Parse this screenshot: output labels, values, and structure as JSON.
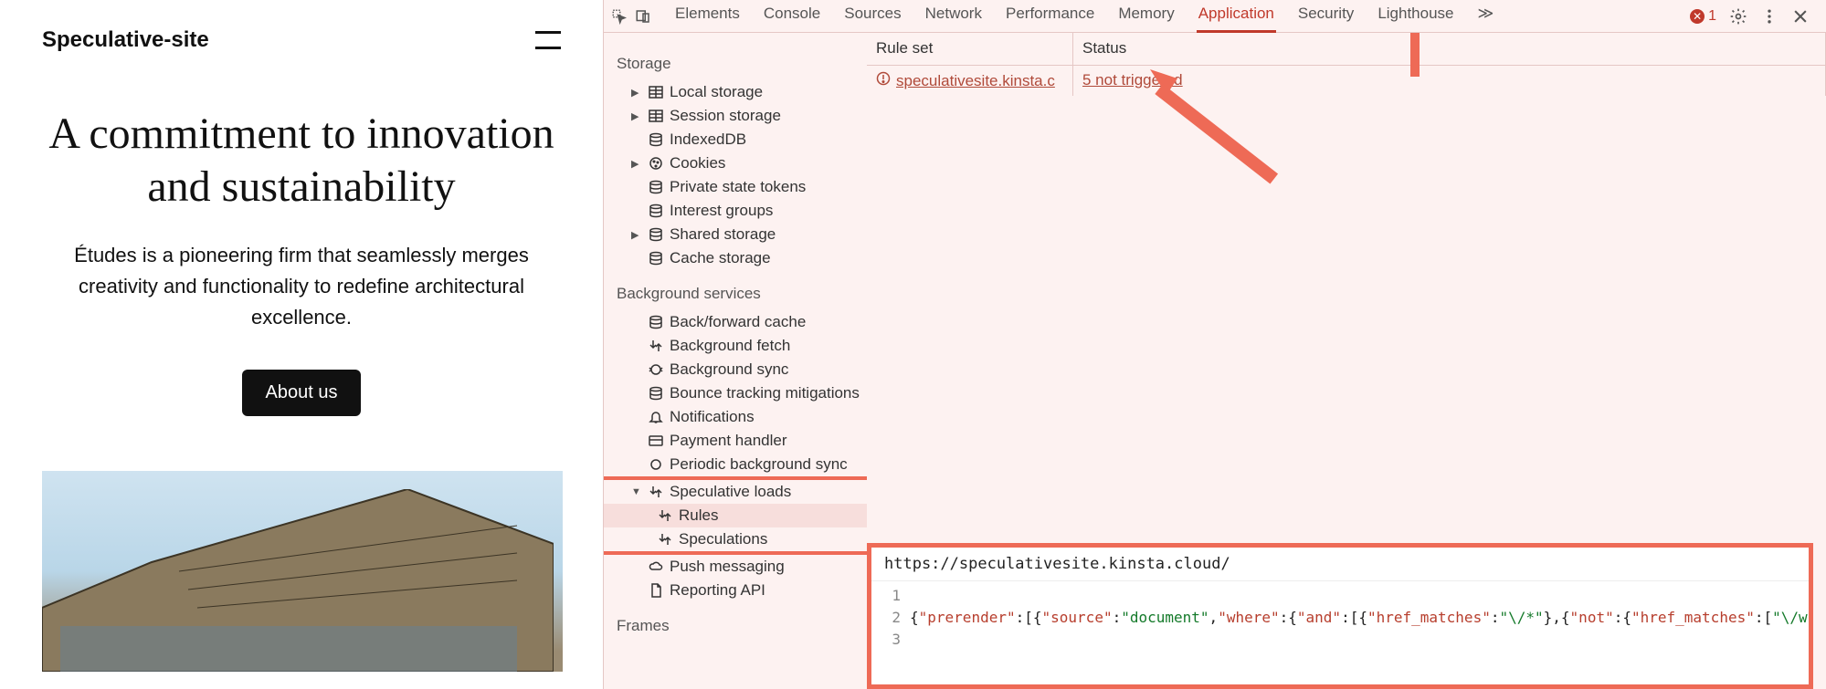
{
  "website": {
    "title": "Speculative-site",
    "heading": "A commitment to innovation and sustainability",
    "sub": "Études is a pioneering firm that seamlessly merges creativity and functionality to redefine architectural excellence.",
    "button": "About us"
  },
  "devtools": {
    "tabs": [
      "Elements",
      "Console",
      "Sources",
      "Network",
      "Performance",
      "Memory",
      "Application",
      "Security",
      "Lighthouse"
    ],
    "activeTab": "Application",
    "errorCount": "1",
    "sidebar": {
      "storage": {
        "title": "Storage",
        "items": [
          "Local storage",
          "Session storage",
          "IndexedDB",
          "Cookies",
          "Private state tokens",
          "Interest groups",
          "Shared storage",
          "Cache storage"
        ]
      },
      "bg": {
        "title": "Background services",
        "items": [
          "Back/forward cache",
          "Background fetch",
          "Background sync",
          "Bounce tracking mitigations",
          "Notifications",
          "Payment handler",
          "Periodic background sync",
          "Speculative loads",
          "Rules",
          "Speculations",
          "Push messaging",
          "Reporting API"
        ]
      },
      "frames": {
        "title": "Frames"
      }
    },
    "columns": {
      "ruleset": "Rule set",
      "status": "Status"
    },
    "row": {
      "ruleset": "speculativesite.kinsta.c",
      "status": "5 not triggered"
    },
    "source": {
      "url": "https://speculativesite.kinsta.cloud/",
      "ln1": "1",
      "ln2": "2",
      "ln3": "3",
      "code": {
        "k_prerender": "\"prerender\"",
        "k_source": "\"source\"",
        "v_document": "\"document\"",
        "k_where": "\"where\"",
        "k_and": "\"and\"",
        "k_href": "\"href_matches\"",
        "v_slashstar": "\"\\/*\"",
        "k_not": "\"not\"",
        "v_wplogin": "\"\\/wp-login."
      }
    }
  }
}
